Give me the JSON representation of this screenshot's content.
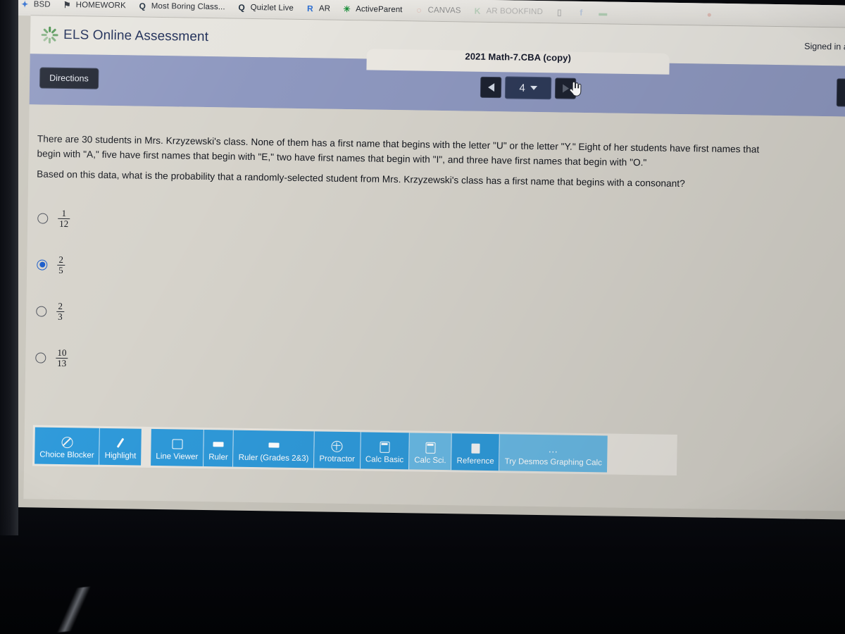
{
  "browser": {
    "bookmarks": [
      {
        "label": "BSD",
        "icon": "star-icon"
      },
      {
        "label": "HOMEWORK",
        "icon": "bell-icon"
      },
      {
        "label": "Most Boring Class...",
        "icon": "quizlet-q-icon"
      },
      {
        "label": "Quizlet Live",
        "icon": "quizlet-q-icon"
      },
      {
        "label": "AR",
        "icon": "renaissance-r-icon"
      },
      {
        "label": "ActiveParent",
        "icon": "globe-icon"
      },
      {
        "label": "CANVAS",
        "icon": "canvas-icon"
      },
      {
        "label": "AR BOOKFIND",
        "icon": "renaissance-k-icon"
      },
      {
        "label": "",
        "icon": "keyboard-icon"
      },
      {
        "label": "",
        "icon": "facebook-icon"
      },
      {
        "label": "",
        "icon": "green-tag-icon"
      },
      {
        "label": "",
        "icon": "red-dot-icon"
      }
    ]
  },
  "header": {
    "brand_title": "ELS Online Assessment",
    "logo_icon": "spinner-logo-icon",
    "signed_in": "Signed in as"
  },
  "toolbar": {
    "assessment_title": "2021 Math-7.CBA (copy)",
    "directions_label": "Directions",
    "prev_icon": "prev-arrow-icon",
    "page_number": "4",
    "page_caret_icon": "chevron-down-icon",
    "next_icon": "next-arrow-icon",
    "cursor_icon": "hand-cursor-icon"
  },
  "question": {
    "paragraph_1": "There are 30 students in Mrs. Krzyzewski's class. None of them has a first name that begins with the letter \"U\" or the letter \"Y.\" Eight of her students have first names that begin with \"A,\" five have first names that begin with \"E,\" two have first names that begin with \"I\", and three have first names that begin with \"O.\"",
    "paragraph_2": "Based on this data, what is the probability that a randomly-selected student from Mrs. Krzyzewski's class has a first name that begins with a consonant?",
    "choices": [
      {
        "numerator": "1",
        "denominator": "12",
        "selected": false
      },
      {
        "numerator": "2",
        "denominator": "5",
        "selected": true
      },
      {
        "numerator": "2",
        "denominator": "3",
        "selected": false
      },
      {
        "numerator": "10",
        "denominator": "13",
        "selected": false
      }
    ],
    "selected_color": "#1558c9"
  },
  "tools": {
    "group_1": [
      {
        "label": "Choice Blocker",
        "icon": "no-entry-icon",
        "style": "solid"
      },
      {
        "label": "Highlight",
        "icon": "pencil-icon",
        "style": "solid"
      }
    ],
    "group_2": [
      {
        "label": "Line Viewer",
        "icon": "line-viewer-icon",
        "style": "solid"
      },
      {
        "label": "Ruler",
        "icon": "ruler-icon",
        "style": "solid"
      },
      {
        "label": "Ruler (Grades 2&3)",
        "icon": "ruler-icon",
        "style": "solid"
      },
      {
        "label": "Protractor",
        "icon": "protractor-icon",
        "style": "solid"
      },
      {
        "label": "Calc Basic",
        "icon": "calculator-icon",
        "style": "solid"
      },
      {
        "label": "Calc Sci.",
        "icon": "calculator-icon",
        "style": "light"
      },
      {
        "label": "Reference",
        "icon": "document-icon",
        "style": "solid"
      },
      {
        "label": "Try Desmos Graphing Calc",
        "icon": "ellipsis-icon",
        "style": "light"
      }
    ]
  },
  "colors": {
    "tool_blue": "#2f9ada",
    "tool_blue_light": "#69b9e4",
    "toolbar_band": "#8e98c0",
    "content_bg": "#d6d3cb",
    "brand_navy": "#1b2a55"
  }
}
